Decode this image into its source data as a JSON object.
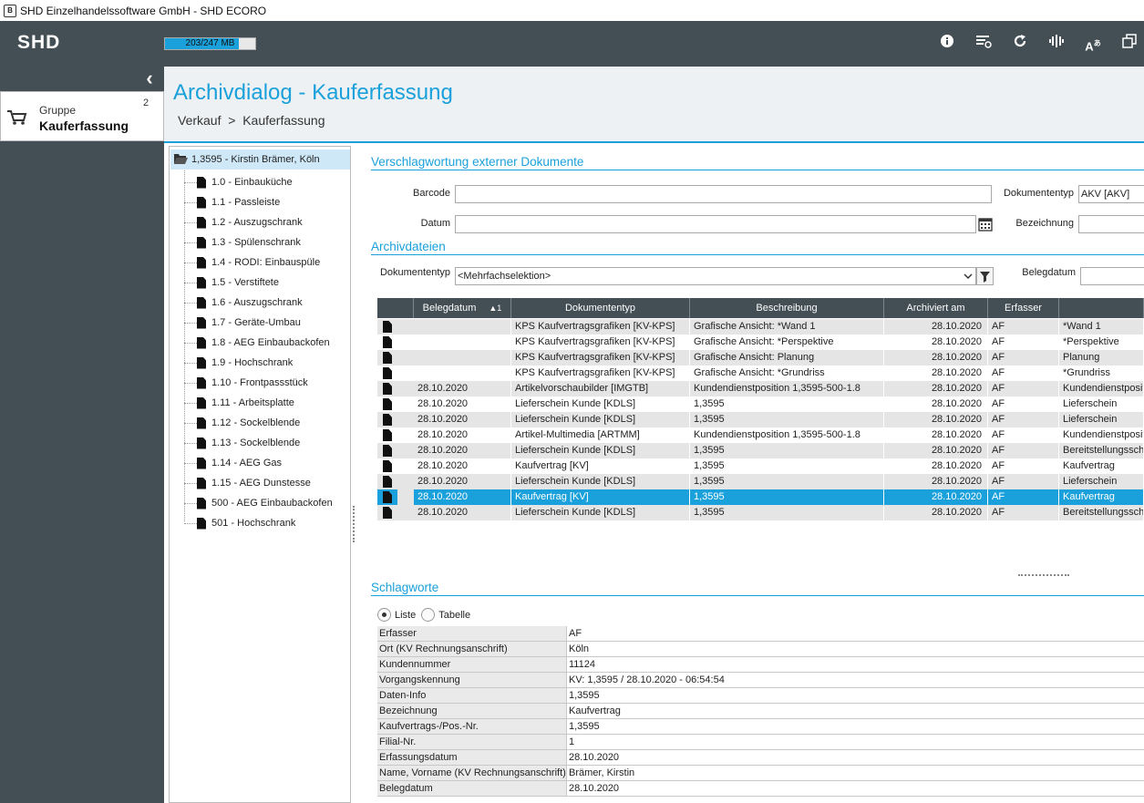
{
  "titlebar": {
    "title": "SHD Einzelhandelssoftware GmbH - SHD ECORO",
    "icon": "app-icon"
  },
  "topbar": {
    "logo": "SHD",
    "memory": {
      "label": "203/247 MB",
      "used_fraction": 0.82
    },
    "icons": [
      "info-icon",
      "settings-list-icon",
      "refresh-icon",
      "split-icon",
      "translate-icon",
      "window-icon"
    ],
    "accent": "#1aa0db",
    "bar_color": "#434e55"
  },
  "sidebar": {
    "group": {
      "caption": "Gruppe",
      "name": "Kauferfassung",
      "count": "2",
      "icon": "cart-icon"
    }
  },
  "header": {
    "title": "Archivdialog - Kauferfassung",
    "breadcrumb": "Verkauf  >  Kauferfassung"
  },
  "tree": {
    "root": "1,3595 - Kirstin Brämer, Köln",
    "items": [
      "1.0 - Einbauküche",
      "1.1 - Passleiste",
      "1.2 - Auszugschrank",
      "1.3 - Spülenschrank",
      "1.4 - RODI: Einbauspüle",
      "1.5 - Verstiftete",
      "1.6 - Auszugschrank",
      "1.7 - Geräte-Umbau",
      "1.8 - AEG Einbaubackofen",
      "1.9 - Hochschrank",
      "1.10 - Frontpassstück",
      "1.11 - Arbeitsplatte",
      "1.12 - Sockelblende",
      "1.13 - Sockelblende",
      "1.14 - AEG Gas",
      "1.15 - AEG Dunstesse",
      "500 - AEG Einbaubackofen",
      "501 - Hochschrank"
    ]
  },
  "section1": {
    "title": "Verschlagwortung externer Dokumente",
    "barcode_label": "Barcode",
    "barcode_value": "",
    "datum_label": "Datum",
    "datum_value": "",
    "doctype_label": "Dokumententyp",
    "doctype_value": "AKV [AKV]",
    "bezeichnung_label": "Bezeichnung",
    "bezeichnung_value": ""
  },
  "section2": {
    "title": "Archivdateien",
    "doctype_label": "Dokumententyp",
    "doctype_value": "<Mehrfachselektion>",
    "belegdatum_label": "Belegdatum",
    "columns": [
      "",
      "Belegdatum",
      "Dokumententyp",
      "Beschreibung",
      "Archiviert am",
      "Erfasser",
      ""
    ],
    "sort_indicator": "▲1",
    "selected_row": 11,
    "rows": [
      [
        "",
        "KPS Kaufvertragsgrafiken [KV-KPS]",
        "Grafische Ansicht: *Wand 1",
        "28.10.2020",
        "AF",
        "*Wand 1"
      ],
      [
        "",
        "KPS Kaufvertragsgrafiken [KV-KPS]",
        "Grafische Ansicht: *Perspektive",
        "28.10.2020",
        "AF",
        "*Perspektive"
      ],
      [
        "",
        "KPS Kaufvertragsgrafiken [KV-KPS]",
        "Grafische Ansicht: Planung",
        "28.10.2020",
        "AF",
        "Planung"
      ],
      [
        "",
        "KPS Kaufvertragsgrafiken [KV-KPS]",
        "Grafische Ansicht: *Grundriss",
        "28.10.2020",
        "AF",
        "*Grundriss"
      ],
      [
        "28.10.2020",
        "Artikelvorschaubilder [IMGTB]",
        "Kundendienstposition 1,3595-500-1.8",
        "28.10.2020",
        "AF",
        "Kundendienstposit"
      ],
      [
        "28.10.2020",
        "Lieferschein Kunde [KDLS]",
        "1,3595",
        "28.10.2020",
        "AF",
        "Lieferschein"
      ],
      [
        "28.10.2020",
        "Lieferschein Kunde [KDLS]",
        "1,3595",
        "28.10.2020",
        "AF",
        "Lieferschein"
      ],
      [
        "28.10.2020",
        "Artikel-Multimedia [ARTMM]",
        "Kundendienstposition 1,3595-500-1.8",
        "28.10.2020",
        "AF",
        "Kundendienstposit"
      ],
      [
        "28.10.2020",
        "Lieferschein Kunde [KDLS]",
        "1,3595",
        "28.10.2020",
        "AF",
        "Bereitstellungssch"
      ],
      [
        "28.10.2020",
        "Kaufvertrag [KV]",
        "1,3595",
        "28.10.2020",
        "AF",
        "Kaufvertrag"
      ],
      [
        "28.10.2020",
        "Lieferschein Kunde [KDLS]",
        "1,3595",
        "28.10.2020",
        "AF",
        "Lieferschein"
      ],
      [
        "28.10.2020",
        "Kaufvertrag [KV]",
        "1,3595",
        "28.10.2020",
        "AF",
        "Kaufvertrag"
      ],
      [
        "28.10.2020",
        "Lieferschein Kunde [KDLS]",
        "1,3595",
        "28.10.2020",
        "AF",
        "Bereitstellungssch"
      ]
    ]
  },
  "section3": {
    "title": "Schlagworte",
    "radio_list": "Liste",
    "radio_table": "Tabelle",
    "selected": "Liste",
    "rows": [
      [
        "Erfasser",
        "AF"
      ],
      [
        "Ort (KV Rechnungsanschrift)",
        "Köln"
      ],
      [
        "Kundennummer",
        "11124"
      ],
      [
        "Vorgangskennung",
        "KV: 1,3595 / 28.10.2020 - 06:54:54"
      ],
      [
        "Daten-Info",
        "1,3595"
      ],
      [
        "Bezeichnung",
        "Kaufvertrag"
      ],
      [
        "Kaufvertrags-/Pos.-Nr.",
        "1,3595"
      ],
      [
        "Filial-Nr.",
        "1"
      ],
      [
        "Erfassungsdatum",
        "28.10.2020"
      ],
      [
        "Name, Vorname (KV Rechnungsanschrift)",
        "Brämer, Kirstin"
      ],
      [
        "Belegdatum",
        "28.10.2020"
      ]
    ]
  }
}
